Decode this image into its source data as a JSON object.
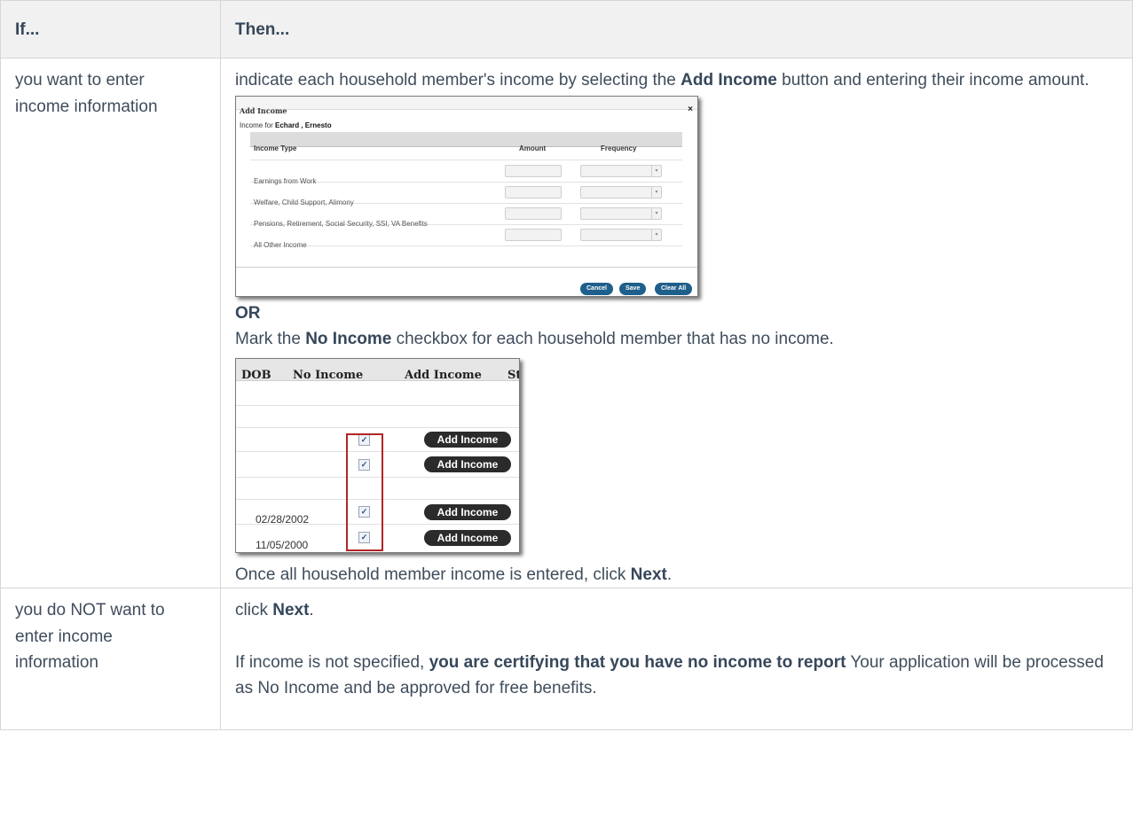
{
  "table": {
    "header_if": "If...",
    "header_then": "Then...",
    "row1": {
      "condition": "you want to enter income information",
      "line1_a": "indicate each household member's income by selecting the ",
      "line1_b": "Add Income",
      "line1_c": " button and entering their income amount.",
      "or": "OR",
      "line2_a": "Mark the ",
      "line2_b": "No Income",
      "line2_c": " checkbox for each household member that has no income.",
      "line3_a": "Once all household member income is entered, click ",
      "line3_b": "Next",
      "line3_c": "."
    },
    "row2": {
      "condition_line1": "you do NOT want to",
      "condition_line2": "enter income information",
      "line1_a": "click ",
      "line1_b": "Next",
      "line1_c": ".",
      "line2_a": "If income is not specified, ",
      "line2_b": "you are certifying that you have no income to report",
      "line2_c": " Your application will be processed as No Income and be approved for free benefits."
    }
  },
  "dialog": {
    "title": "Add Income",
    "close": "×",
    "for_prefix": "Income for ",
    "for_name": "Echard , Ernesto",
    "col_type": "Income Type",
    "col_amount": "Amount",
    "col_frequency": "Frequency",
    "rows": [
      "Earnings from Work",
      "Welfare, Child Support, Alimony",
      "Pensions, Retirement, Social Security, SSI, VA Benefits",
      "All Other Income"
    ],
    "btn_cancel": "Cancel",
    "btn_save": "Save",
    "btn_clear": "Clear All"
  },
  "grid": {
    "col_dob": "DOB",
    "col_no_income": "No Income",
    "col_add_income": "Add Income",
    "col_status": "St",
    "check": "✓",
    "add_income_label": "Add Income",
    "dob_1": "02/28/2002",
    "dob_2": "11/05/2000"
  }
}
